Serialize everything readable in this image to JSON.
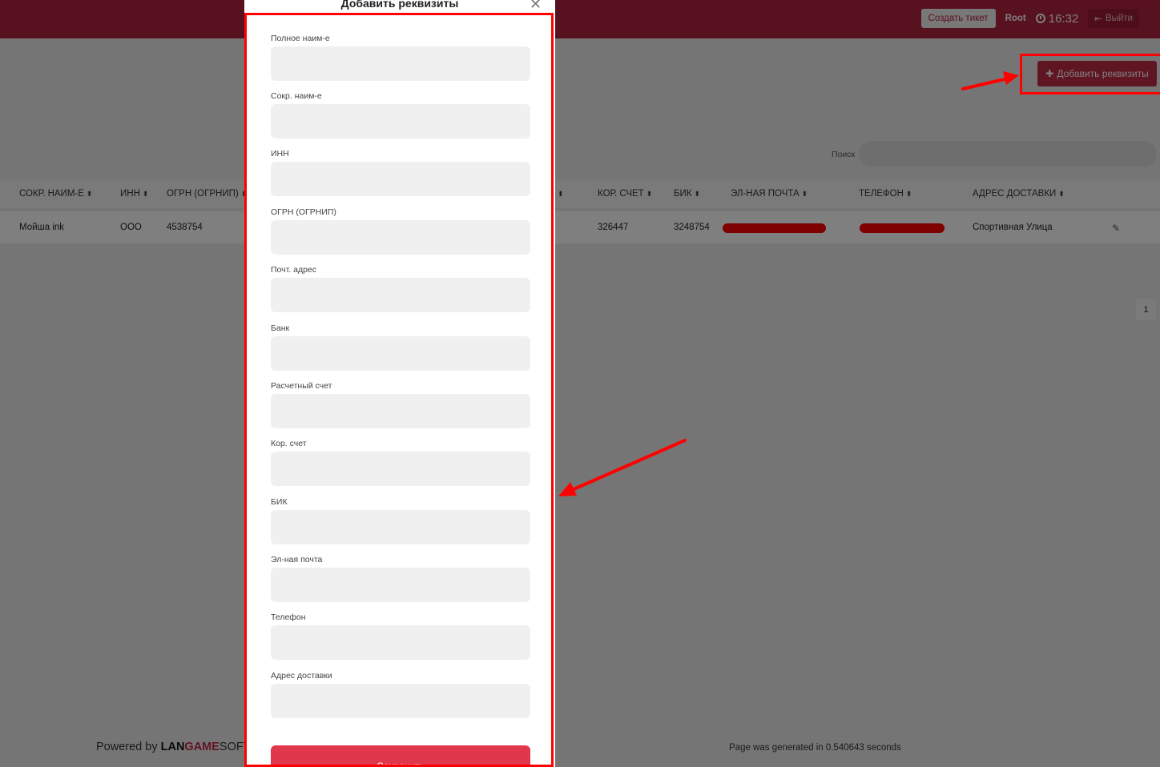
{
  "topbar": {
    "create_ticket": "Создать тикет",
    "user": "Root",
    "time": "16:32",
    "logout": "Выйти"
  },
  "actions": {
    "add_requisites": "Добавить реквизиты"
  },
  "search": {
    "label": "Поиск"
  },
  "table": {
    "columns": [
      "СОКР. НАИМ-Е",
      "ИНН",
      "ОГРН (ОГРНИП)",
      "",
      "КОР. СЧЕТ",
      "БИК",
      "ЭЛ-НАЯ ПОЧТА",
      "ТЕЛЕФОН",
      "АДРЕС ДОСТАВКИ"
    ],
    "row": {
      "short_name": "Мойша ink",
      "inn": "ООО",
      "ogrn": "4538754",
      "kor_schet": "326447",
      "bik": "3248754",
      "address": "Спортивная Улица"
    }
  },
  "pagination": {
    "current": "1"
  },
  "footer": {
    "powered_by": "Powered by",
    "brand_lan": "LAN",
    "brand_game": "GAME",
    "brand_soft": "SOFT",
    "generated": "Page was generated in 0.540643 seconds"
  },
  "modal": {
    "title": "Добавить реквизиты",
    "fields": [
      {
        "label": "Полное наим-е",
        "value": ""
      },
      {
        "label": "Сокр. наим-е",
        "value": ""
      },
      {
        "label": "ИНН",
        "value": ""
      },
      {
        "label": "ОГРН (ОГРНИП)",
        "value": ""
      },
      {
        "label": "Почт. адрес",
        "value": ""
      },
      {
        "label": "Банк",
        "value": ""
      },
      {
        "label": "Расчетный счет",
        "value": ""
      },
      {
        "label": "Кор. счет",
        "value": ""
      },
      {
        "label": "БИК",
        "value": ""
      },
      {
        "label": "Эл-ная почта",
        "value": ""
      },
      {
        "label": "Телефон",
        "value": ""
      },
      {
        "label": "Адрес доставки",
        "value": ""
      }
    ],
    "save": "Сохранить"
  },
  "icons": {
    "clock": "clock-icon",
    "logout": "logout-icon",
    "plus": "plus-icon",
    "close": "close-icon",
    "edit": "pencil-icon",
    "sort": "sort-icon"
  },
  "colors": {
    "brand": "#b0223c",
    "primary_button": "#e0374d",
    "annotation": "#ff0000"
  }
}
